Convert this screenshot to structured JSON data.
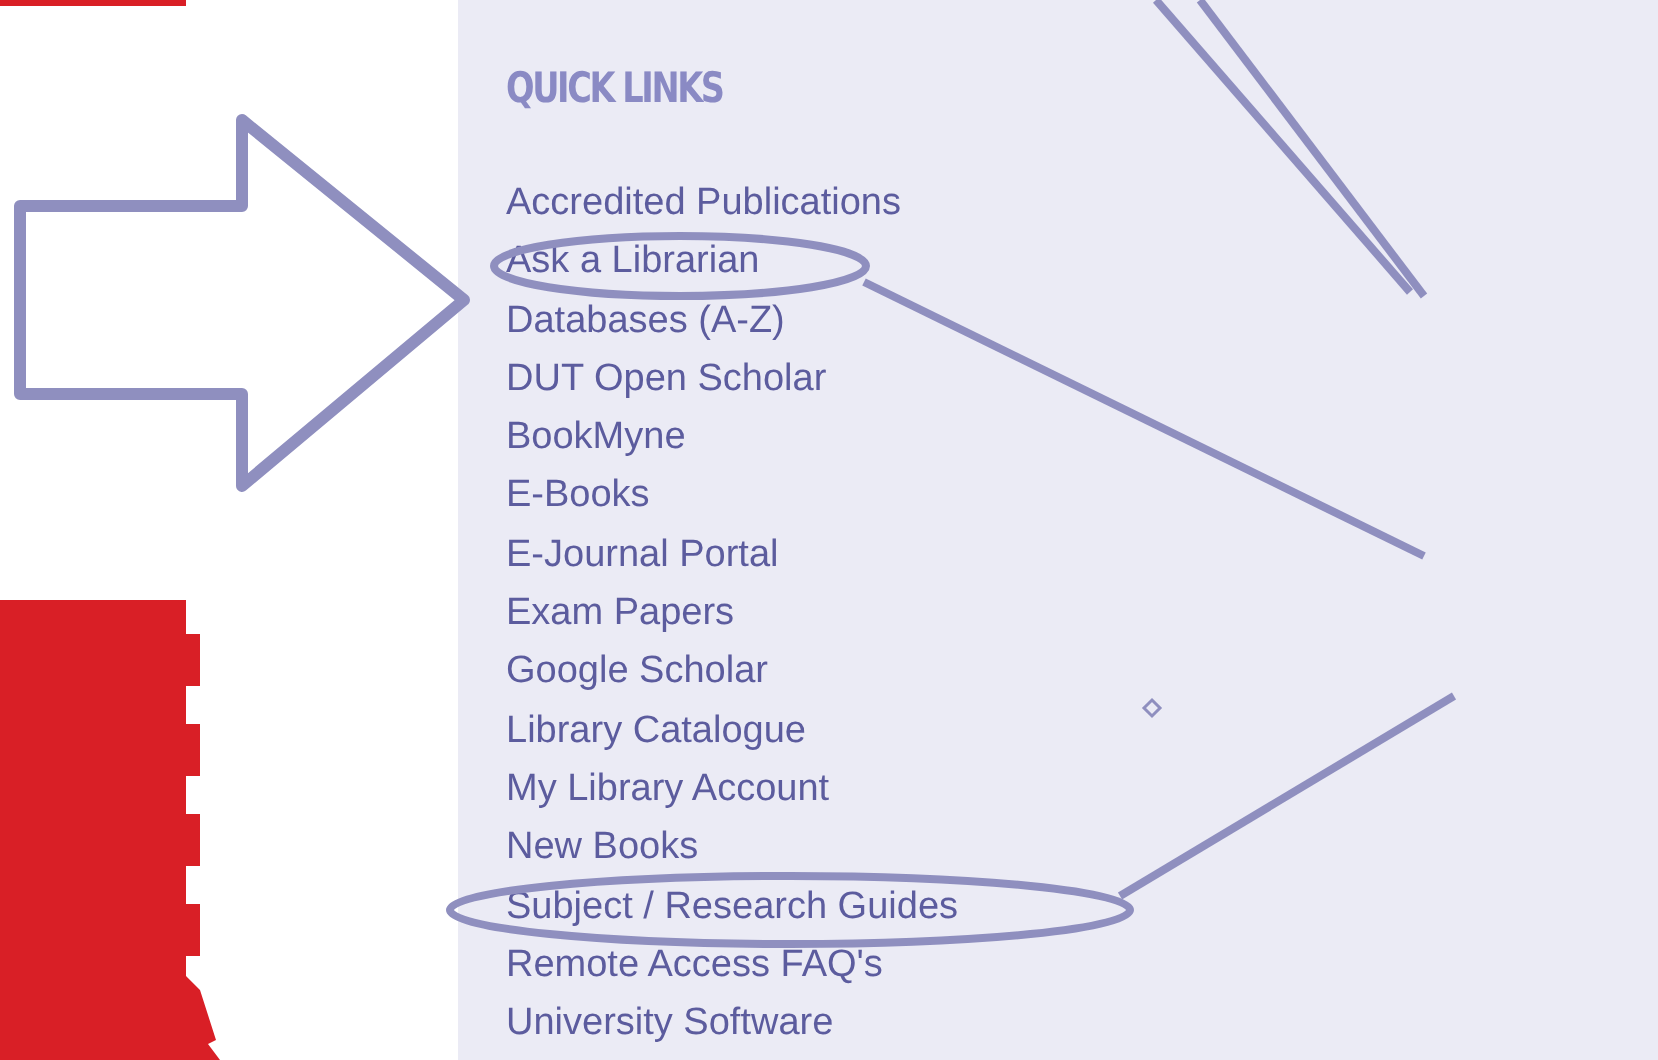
{
  "quick_links": {
    "title": "QUICK LINKS",
    "items": [
      "Accredited Publications",
      "Ask a Librarian",
      "Databases (A-Z)",
      "DUT Open Scholar",
      "BookMyne",
      "E-Books",
      "E-Journal Portal",
      "Exam Papers",
      "Google Scholar",
      "Library Catalogue",
      "My Library Account",
      "New Books",
      "Subject / Research Guides",
      "Remote Access FAQ's",
      "University Software"
    ]
  }
}
